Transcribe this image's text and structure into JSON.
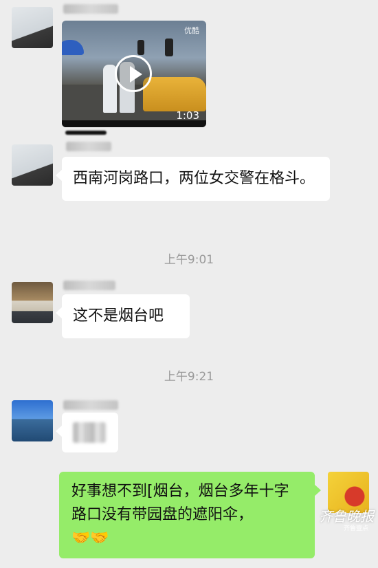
{
  "video_message": {
    "duration": "1:03",
    "source_tag": "优酷"
  },
  "messages": [
    {
      "text": "西南河岗路口，两位女交警在格斗。"
    },
    {
      "text": "这不是烟台吧"
    },
    {
      "text": "好事想不到[烟台，烟台多年十字路口没有带园盘的遮阳伞，"
    }
  ],
  "timestamps": [
    "上午9:01",
    "上午9:21"
  ],
  "reaction_emoji": "🤝🤝",
  "watermark": {
    "brand": "齐鲁晚报",
    "sub": "齐鲁壹点"
  },
  "colors": {
    "chat_background": "#ededed",
    "incoming_bubble": "#ffffff",
    "outgoing_bubble": "#95ec69",
    "timestamp_text": "#9a9a9a"
  }
}
